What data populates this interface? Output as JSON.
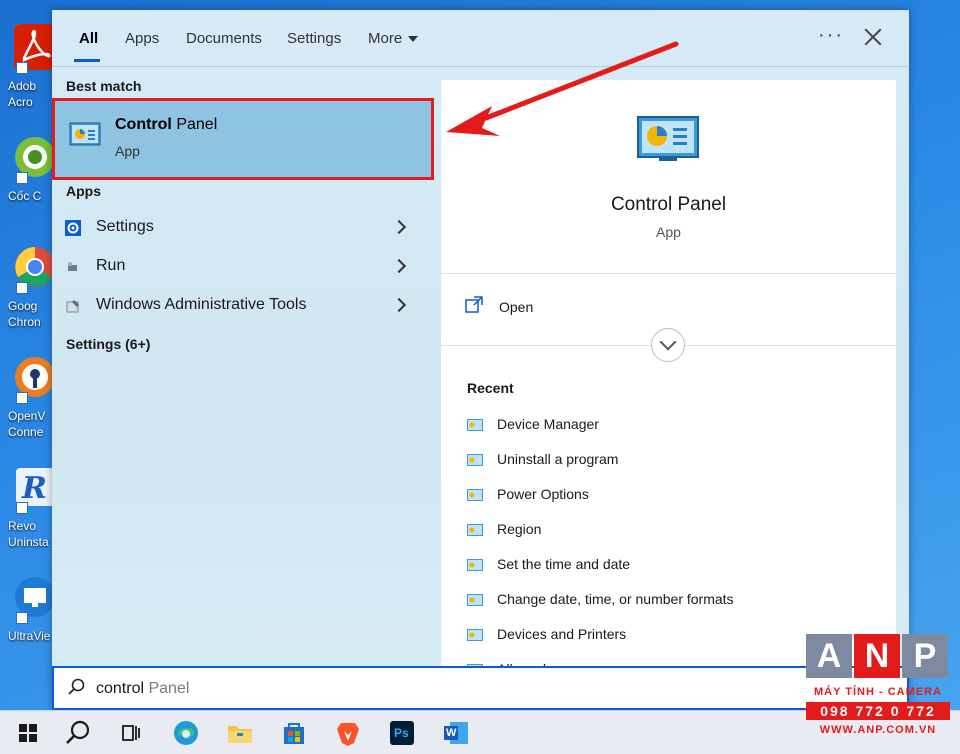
{
  "desktop": {
    "icons": [
      {
        "label": "Adob\nAcro",
        "icon": "adobe-acrobat-icon",
        "color": "#d81e05"
      },
      {
        "label": "Cốc C",
        "icon": "coc-coc-browser-icon",
        "color": "#7bbd3c"
      },
      {
        "label": "Goog\nChron",
        "icon": "google-chrome-icon",
        "color": "#dd4b3e"
      },
      {
        "label": "OpenV\nConne",
        "icon": "openvpn-icon",
        "color": "#ea7e20"
      },
      {
        "label": "Revo\nUninsta",
        "icon": "revo-uninstaller-icon",
        "color": "#1d5fbf"
      },
      {
        "label": "UltraVie",
        "icon": "ultraviewer-icon",
        "color": "#1f7ad6"
      }
    ]
  },
  "tabs": {
    "all": "All",
    "apps": "Apps",
    "documents": "Documents",
    "settings": "Settings",
    "more": "More",
    "ellipsis": "···"
  },
  "results": {
    "best_match_heading": "Best match",
    "best_match": {
      "title_bold": "Control",
      "title_rest": " Panel",
      "subtitle": "App"
    },
    "apps_heading": "Apps",
    "apps": [
      {
        "name": "Settings",
        "icon": "gear-icon"
      },
      {
        "name": "Run",
        "icon": "run-icon"
      },
      {
        "name": "Windows Administrative Tools",
        "icon": "admin-tools-icon"
      }
    ],
    "settings_heading": "Settings (6+)"
  },
  "preview": {
    "title": "Control Panel",
    "subtitle": "App",
    "open_label": "Open",
    "recent_heading": "Recent",
    "recent": [
      "Device Manager",
      "Uninstall a program",
      "Power Options",
      "Region",
      "Set the time and date",
      "Change date, time, or number formats",
      "Devices and Printers",
      "Allowed apps"
    ]
  },
  "search": {
    "typed": "control",
    "suggestion": " Panel"
  },
  "taskbar": {
    "items": [
      "windows-start-icon",
      "search-icon",
      "task-view-icon",
      "edge-icon",
      "file-explorer-icon",
      "microsoft-store-icon",
      "brave-icon",
      "photoshop-icon",
      "word-icon"
    ],
    "photoshop_label": "Ps",
    "word_label": "W"
  },
  "watermark": {
    "letters": [
      "A",
      "N",
      "P"
    ],
    "line1": "MÁY TÍNH - CAMERA",
    "line2": "098 772 0 772",
    "line3": "WWW.ANP.COM.VN"
  },
  "colors": {
    "accent": "#0a5bd6",
    "highlight": "#8fc3e2",
    "annotation_red": "#e41b1b"
  }
}
